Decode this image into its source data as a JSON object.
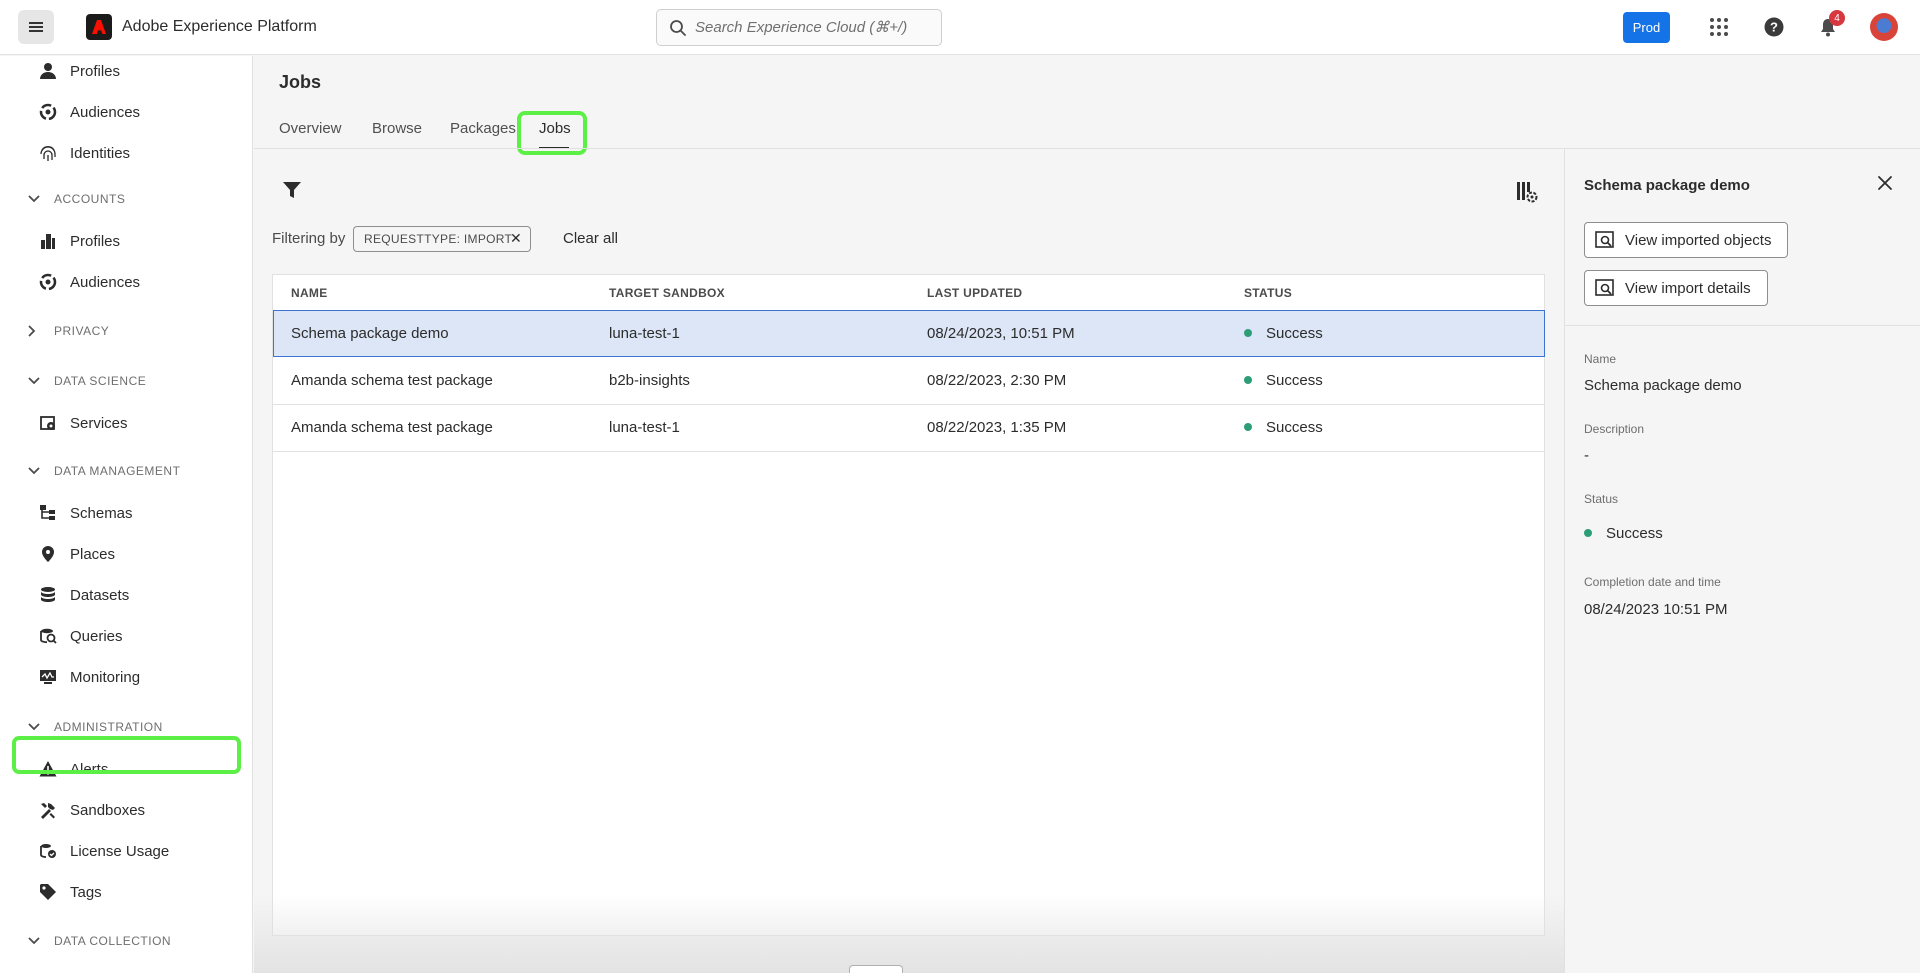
{
  "app": {
    "title": "Adobe Experience Platform",
    "environment": "Prod",
    "notifications_count": "4",
    "search_placeholder": "Search Experience Cloud (⌘+/)"
  },
  "sidebar": {
    "items": [
      {
        "label": "Profiles",
        "icon": "person-icon"
      },
      {
        "label": "Audiences",
        "icon": "audiences-icon"
      },
      {
        "label": "Identities",
        "icon": "fingerprint-icon"
      }
    ],
    "sections": [
      {
        "label": "ACCOUNTS",
        "expanded": true,
        "items": [
          {
            "label": "Profiles",
            "icon": "building-icon"
          },
          {
            "label": "Audiences",
            "icon": "audiences-icon"
          }
        ]
      },
      {
        "label": "PRIVACY",
        "expanded": false,
        "items": []
      },
      {
        "label": "DATA SCIENCE",
        "expanded": true,
        "items": [
          {
            "label": "Services",
            "icon": "services-icon"
          }
        ]
      },
      {
        "label": "DATA MANAGEMENT",
        "expanded": true,
        "items": [
          {
            "label": "Schemas",
            "icon": "schema-icon"
          },
          {
            "label": "Places",
            "icon": "pin-icon"
          },
          {
            "label": "Datasets",
            "icon": "database-icon"
          },
          {
            "label": "Queries",
            "icon": "query-icon"
          },
          {
            "label": "Monitoring",
            "icon": "monitoring-icon"
          }
        ]
      },
      {
        "label": "ADMINISTRATION",
        "expanded": true,
        "items": [
          {
            "label": "Alerts",
            "icon": "alert-icon"
          },
          {
            "label": "Sandboxes",
            "icon": "sandbox-icon"
          },
          {
            "label": "License Usage",
            "icon": "license-icon"
          },
          {
            "label": "Tags",
            "icon": "tag-icon"
          }
        ]
      },
      {
        "label": "DATA COLLECTION",
        "expanded": true,
        "items": []
      }
    ]
  },
  "main": {
    "page_title": "Jobs",
    "tabs": [
      "Overview",
      "Browse",
      "Packages",
      "Jobs"
    ],
    "active_tab": "Jobs",
    "filter": {
      "label": "Filtering by",
      "chip": "REQUESTTYPE: IMPORT",
      "clear_all": "Clear all"
    },
    "table": {
      "columns": [
        "NAME",
        "TARGET SANDBOX",
        "LAST UPDATED",
        "STATUS"
      ],
      "rows": [
        {
          "name": "Schema package demo",
          "sandbox": "luna-test-1",
          "updated": "08/24/2023, 10:51 PM",
          "status": "Success"
        },
        {
          "name": "Amanda schema test package",
          "sandbox": "b2b-insights",
          "updated": "08/22/2023, 2:30 PM",
          "status": "Success"
        },
        {
          "name": "Amanda schema test package",
          "sandbox": "luna-test-1",
          "updated": "08/22/2023, 1:35 PM",
          "status": "Success"
        }
      ],
      "selected_row": 0
    }
  },
  "panel": {
    "title": "Schema package demo",
    "buttons": [
      "View imported objects",
      "View import details"
    ],
    "fields": [
      {
        "label": "Name",
        "value": "Schema package demo"
      },
      {
        "label": "Description",
        "value": "-"
      },
      {
        "label": "Status",
        "value": "Success"
      },
      {
        "label": "Completion date and time",
        "value": "08/24/2023 10:51 PM"
      }
    ]
  },
  "colors": {
    "accent": "#1473e6",
    "success": "#2d9d78",
    "highlight": "#5cf046",
    "selected_row": "#dce6f7",
    "badge": "#d7373f"
  }
}
